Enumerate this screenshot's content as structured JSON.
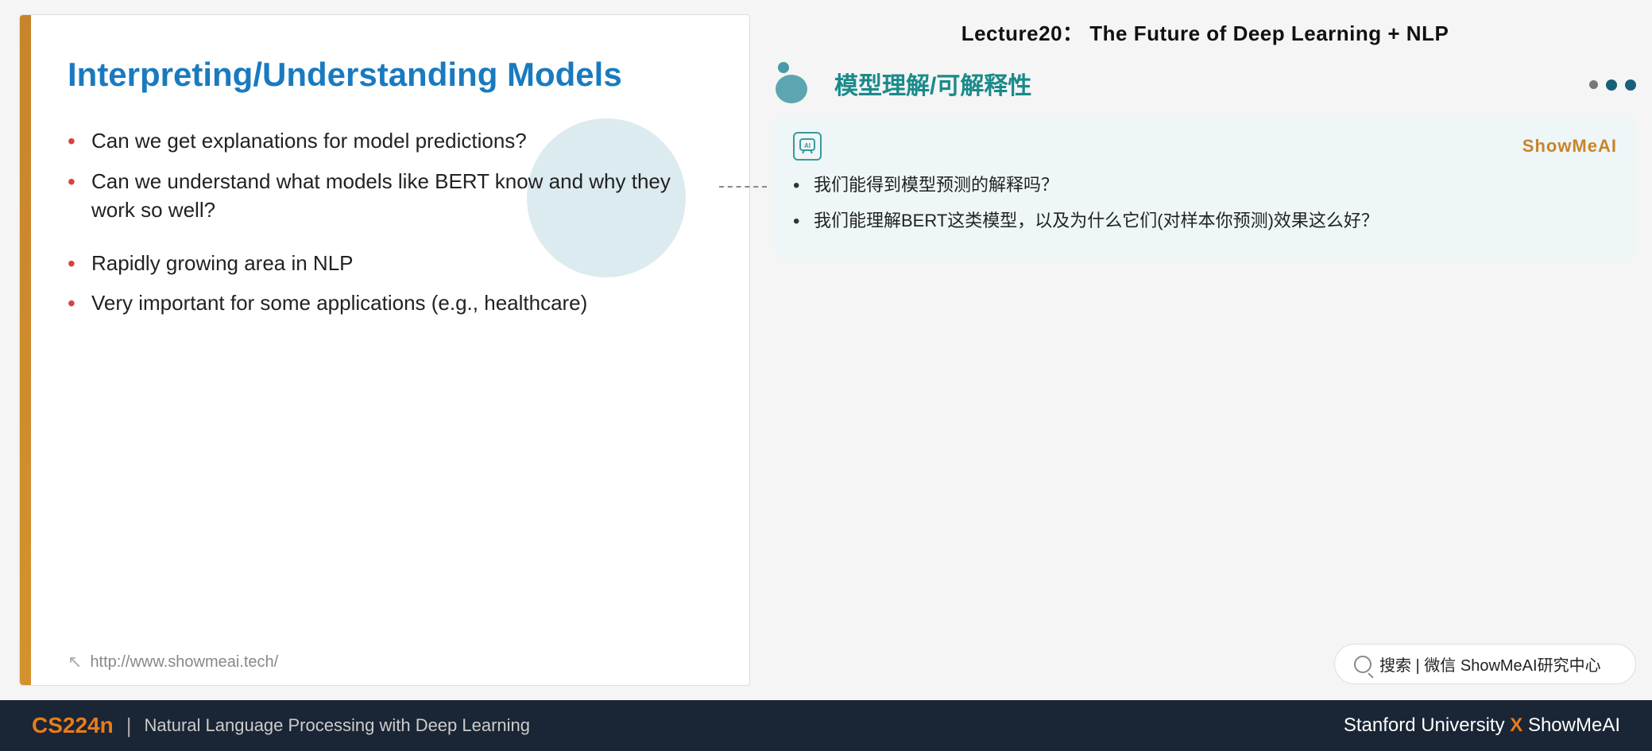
{
  "header": {
    "lecture_title": "Lecture20： The Future of Deep Learning + NLP"
  },
  "slide": {
    "title": "Interpreting/Understanding Models",
    "bullets_group1": [
      "Can we get explanations for model predictions?",
      "Can we understand what models like BERT know and why they work so well?"
    ],
    "bullets_group2": [
      "Rapidly growing area in NLP",
      "Very important for some applications (e.g., healthcare)"
    ],
    "footer_url": "http://www.showmeai.tech/"
  },
  "right_panel": {
    "section_title_cn": "模型理解/可解释性",
    "card": {
      "brand": "ShowMeAI",
      "bullets": [
        "我们能得到模型预测的解释吗？",
        "我们能理解BERT这类模型，以及为什么它们(对样本你预测)效果这么好？"
      ]
    },
    "search_bar": {
      "icon_label": "search",
      "divider": "|",
      "text": "搜索 | 微信 ShowMeAI研究中心"
    }
  },
  "bottom_bar": {
    "course_code": "CS224n",
    "divider": "|",
    "course_name": "Natural Language Processing with Deep Learning",
    "university": "Stanford University",
    "x_mark": "X",
    "brand": "ShowMeAI"
  }
}
